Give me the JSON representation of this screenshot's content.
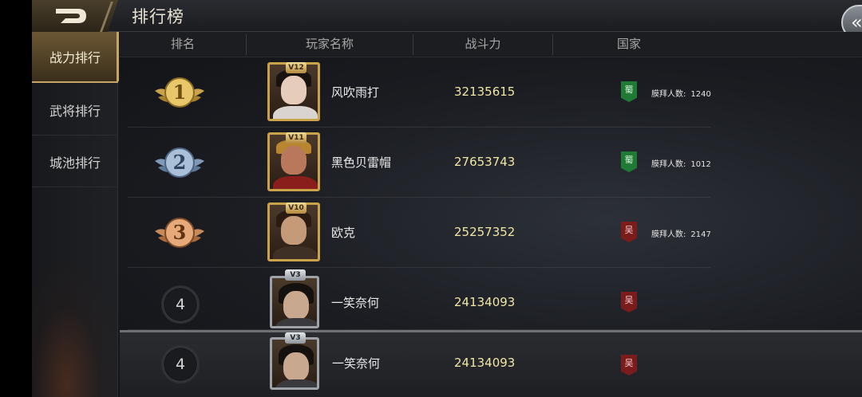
{
  "header": {
    "title": "排行榜",
    "back_icon": "back-arrow-icon",
    "close_icon": "double-chevron-left-icon"
  },
  "sidebar": {
    "items": [
      {
        "label": "战力排行",
        "active": true
      },
      {
        "label": "武将排行",
        "active": false
      },
      {
        "label": "城池排行",
        "active": false
      }
    ]
  },
  "columns": {
    "rank": "排名",
    "player": "玩家名称",
    "power": "战斗力",
    "country": "国家"
  },
  "rows": [
    {
      "rank": "1",
      "medal": "gold",
      "vip": "V12",
      "name": "风吹雨打",
      "power": "32135615",
      "country": "蜀",
      "worship_label": "膜拜人数:",
      "worship_count": "1240"
    },
    {
      "rank": "2",
      "medal": "silver",
      "vip": "V11",
      "name": "黑色贝雷帽",
      "power": "27653743",
      "country": "蜀",
      "worship_label": "膜拜人数:",
      "worship_count": "1012"
    },
    {
      "rank": "3",
      "medal": "bronze",
      "vip": "V10",
      "name": "欧克",
      "power": "25257352",
      "country": "吴",
      "worship_label": "膜拜人数:",
      "worship_count": "2147"
    },
    {
      "rank": "4",
      "vip": "V3",
      "name": "一笑奈何",
      "power": "24134093",
      "country": "吴"
    }
  ],
  "self_row": {
    "rank": "4",
    "vip": "V3",
    "name": "一笑奈何",
    "power": "24134093",
    "country": "吴"
  },
  "colors": {
    "gold": "#c9a24a",
    "power_text": "#f0e7a6",
    "shu": "#1e7a34",
    "wu": "#7a1c1c"
  }
}
